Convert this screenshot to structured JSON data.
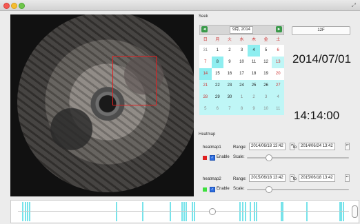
{
  "window": {
    "controls": [
      "close",
      "minimize",
      "zoom"
    ],
    "resize_icon": "resize-arrows-icon"
  },
  "seek": {
    "section_label": "Seek",
    "calendar": {
      "month_label": "9月, 2014",
      "prev_icon": "prev-month-icon",
      "next_icon": "next-month-icon",
      "weekdays": [
        "日",
        "月",
        "火",
        "水",
        "木",
        "金",
        "土"
      ],
      "weeks": [
        [
          "31",
          "1",
          "2",
          "3",
          "4",
          "5",
          "6"
        ],
        [
          "7",
          "8",
          "9",
          "10",
          "11",
          "12",
          "13"
        ],
        [
          "14",
          "15",
          "16",
          "17",
          "18",
          "19",
          "20"
        ],
        [
          "21",
          "22",
          "23",
          "24",
          "25",
          "26",
          "27"
        ],
        [
          "28",
          "29",
          "30",
          "1",
          "2",
          "3",
          "4"
        ],
        [
          "5",
          "6",
          "7",
          "8",
          "9",
          "10",
          "11"
        ]
      ]
    },
    "floor_button": "12F",
    "date_display": "2014/07/01",
    "time_display": "14:14:00"
  },
  "heatmap": {
    "section_label": "Heatmap",
    "rows": [
      {
        "name": "heatmap1",
        "range_label": "Range:",
        "from": "2014/06/18 13:42",
        "to_label": "to",
        "to": "2014/06/24 13:42",
        "color": "#e02020",
        "enable_label": "Enable",
        "enabled": true,
        "scale_label": "Scale:"
      },
      {
        "name": "heatmap2",
        "range_label": "Range:",
        "from": "2015/06/18 13:42",
        "to_label": "to",
        "to": "2015/06/18 13:42",
        "color": "#3ee03e",
        "enable_label": "Enable",
        "enabled": true,
        "scale_label": "Scale:"
      }
    ]
  },
  "colors": {
    "timeline_mark": "#77e3ea",
    "calendar_highlight": "#8eeef0"
  }
}
